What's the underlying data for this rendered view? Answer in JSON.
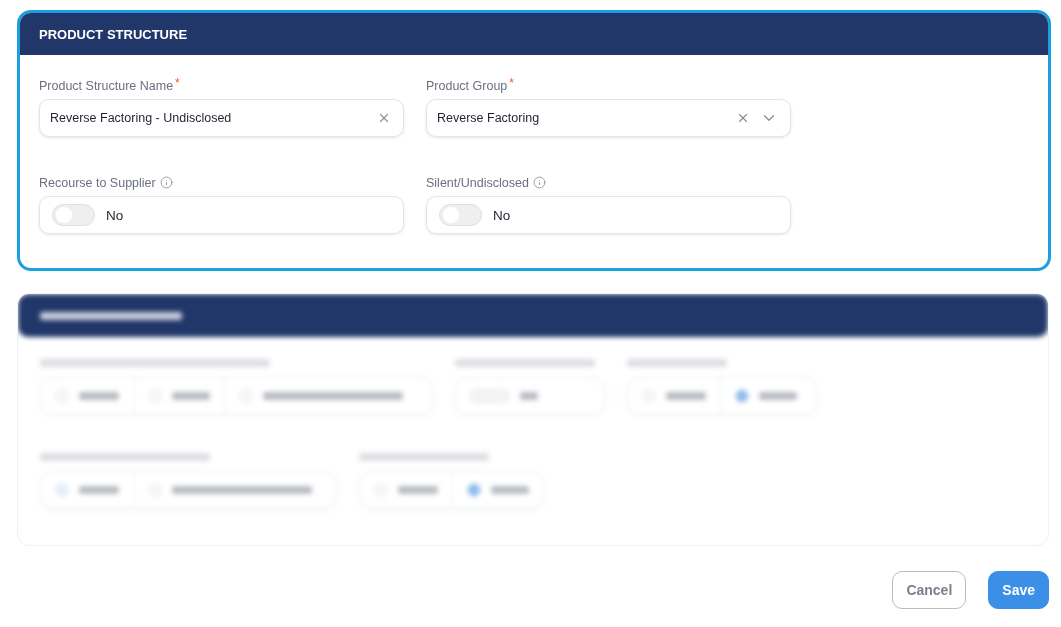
{
  "section": {
    "title": "PRODUCT STRUCTURE"
  },
  "fields": [
    {
      "kind": "text",
      "label": "Product Structure Name",
      "required_mark": "*",
      "value": "Reverse Factoring - Undisclosed",
      "clearable": true
    },
    {
      "kind": "select",
      "label": "Product Group",
      "required_mark": "*",
      "value": "Reverse Factoring",
      "clearable": true
    }
  ],
  "toggles": [
    {
      "label": "Recourse to Supplier",
      "info": true,
      "on": false,
      "value_text": "No"
    },
    {
      "label": "Silent/Undisclosed",
      "info": true,
      "on": false,
      "value_text": "No"
    }
  ],
  "buttons": [
    {
      "kind": "secondary",
      "label": "Cancel"
    },
    {
      "kind": "primary",
      "label": "Save"
    }
  ]
}
